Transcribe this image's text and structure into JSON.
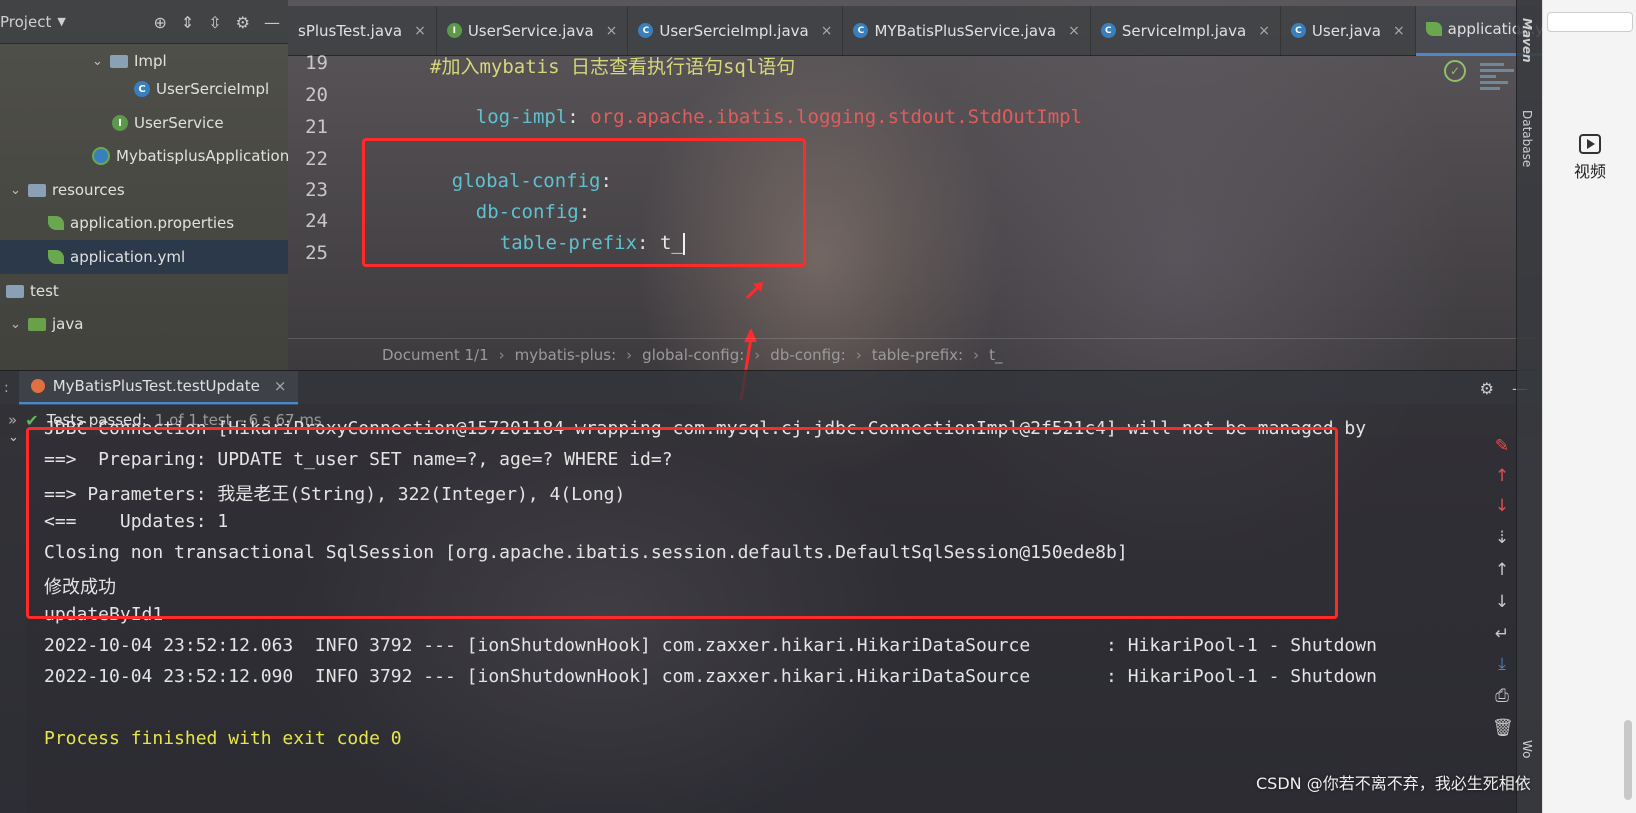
{
  "project": {
    "title": "Project",
    "tree": [
      {
        "label": "Impl",
        "kind": "folder"
      },
      {
        "label": "UserSercieImpl",
        "kind": "class"
      },
      {
        "label": "UserService",
        "kind": "interface"
      },
      {
        "label": "MybatisplusApplication",
        "kind": "app"
      },
      {
        "label": "resources",
        "kind": "folder"
      },
      {
        "label": "application.properties",
        "kind": "config"
      },
      {
        "label": "application.yml",
        "kind": "config",
        "selected": true
      },
      {
        "label": "test",
        "kind": "folder"
      },
      {
        "label": "java",
        "kind": "folder"
      }
    ]
  },
  "tabs": [
    {
      "label": "sPlusTest.java",
      "icon": "none"
    },
    {
      "label": "UserService.java",
      "icon": "I"
    },
    {
      "label": "UserSercieImpl.java",
      "icon": "C"
    },
    {
      "label": "MYBatisPlusService.java",
      "icon": "C"
    },
    {
      "label": "ServiceImpl.java",
      "icon": "C"
    },
    {
      "label": "User.java",
      "icon": "C"
    },
    {
      "label": "application.yml",
      "icon": "yml",
      "active": true
    }
  ],
  "editor": {
    "line_numbers": [
      "19",
      "20",
      "21",
      "22",
      "23",
      "24",
      "25"
    ],
    "comment": "#加入mybatis 日志查看执行语句sql语句",
    "log_impl_key": "log-impl",
    "log_impl_value": "org.apache.ibatis.logging.stdout.StdOutImpl",
    "global_config_key": "global-config",
    "db_config_key": "db-config",
    "table_prefix_key": "table-prefix",
    "table_prefix_value": "t_",
    "colon": ":"
  },
  "breadcrumb": {
    "document": "Document 1/1",
    "items": [
      "mybatis-plus:",
      "global-config:",
      "db-config:",
      "table-prefix:",
      "t_"
    ],
    "separator": "›"
  },
  "run": {
    "tab_label": "MyBatisPlusTest.testUpdate",
    "tests_passed": "Tests passed:",
    "tests_detail": "1 of 1 test – 6 s 67 ms"
  },
  "console": {
    "lines": [
      "JDBC Connection [HikariProxyConnection@157201184 wrapping com.mysql.cj.jdbc.ConnectionImpl@2f521c4] will not be managed by",
      "==>  Preparing: UPDATE t_user SET name=?, age=? WHERE id=?",
      "==> Parameters: 我是老王(String), 322(Integer), 4(Long)",
      "<==    Updates: 1",
      "Closing non transactional SqlSession [org.apache.ibatis.session.defaults.DefaultSqlSession@150ede8b]",
      "修改成功",
      "updateById1",
      "2022-10-04 23:52:12.063  INFO 3792 --- [ionShutdownHook] com.zaxxer.hikari.HikariDataSource       : HikariPool-1 - Shutdown",
      "2022-10-04 23:52:12.090  INFO 3792 --- [ionShutdownHook] com.zaxxer.hikari.HikariDataSource       : HikariPool-1 - Shutdown"
    ],
    "exit_line": "Process finished with exit code 0"
  },
  "right_strip": {
    "maven": "Maven",
    "database": "Database",
    "workspace": "Wo"
  },
  "browser": {
    "video_label": "视频"
  },
  "watermark": "CSDN @你若不离不弃，我必生死相依",
  "colors": {
    "highlight_box": "#ff2a2a",
    "yaml_key": "#5ec1d0",
    "yaml_value": "#e35c5c",
    "comment": "#d6d87a",
    "exit_text": "#e6e64a",
    "tests_passed_check": "#5fb85f"
  },
  "icons": [
    "target-icon",
    "collapse-icon",
    "expand-icon",
    "gear-icon",
    "minimize-icon",
    "chevron-down-icon",
    "check-icon",
    "edit-icon",
    "arrow-up-icon",
    "arrow-down-icon",
    "wrap-icon",
    "scroll-end-icon",
    "print-icon",
    "trash-icon",
    "video-icon"
  ]
}
